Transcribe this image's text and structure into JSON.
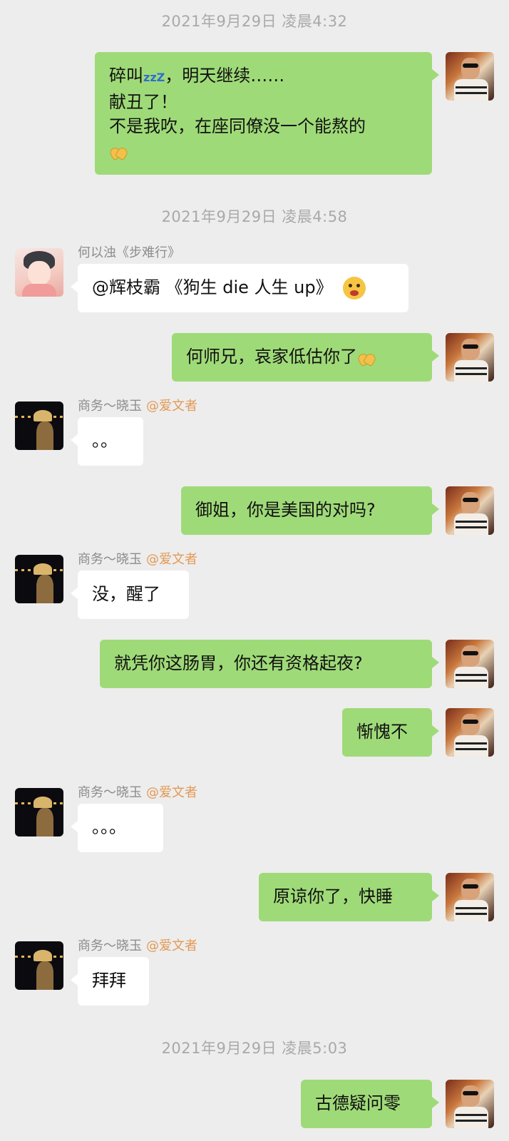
{
  "timestamps": [
    "2021年9月29日 凌晨4:32",
    "2021年9月29日 凌晨4:58",
    "2021年9月29日 凌晨5:03"
  ],
  "senders": {
    "he": {
      "name": "何以浊《步难行》"
    },
    "xiaoyu": {
      "name": "商务～晓玉",
      "tag": "@爱文者"
    }
  },
  "messages": {
    "m1": {
      "line1_pre": "碎叫",
      "zzz": "zzZ",
      "line1_post": "，明天继续……",
      "line2": "献丑了！",
      "line3": "不是我吹，在座同僚没一个能熬的"
    },
    "m2": {
      "text": "@辉枝霸 《狗生 die 人生 up》"
    },
    "m3": {
      "text": "何师兄，哀家低估你了"
    },
    "m4": {
      "text": "。。"
    },
    "m5": {
      "text": "御姐，你是美国的对吗?"
    },
    "m6": {
      "text": "没，醒了"
    },
    "m7": {
      "text": "就凭你这肠胃，你还有资格起夜?"
    },
    "m8": {
      "text": "惭愧不"
    },
    "m9": {
      "text": "。。。"
    },
    "m10": {
      "text": "原谅你了，快睡"
    },
    "m11": {
      "text": "拜拜"
    },
    "m12": {
      "text": "古德疑问零"
    }
  },
  "colors": {
    "background": "#ededed",
    "bubble_sent": "#9fda78",
    "bubble_received": "#ffffff",
    "timestamp": "#a9a9a9",
    "mention_tag": "#e39955"
  },
  "icons": [
    "avatar-me",
    "avatar-he",
    "avatar-xiaoyu",
    "folded-hands-emoji",
    "face-with-mask-emoji",
    "sleeping-zzz"
  ]
}
